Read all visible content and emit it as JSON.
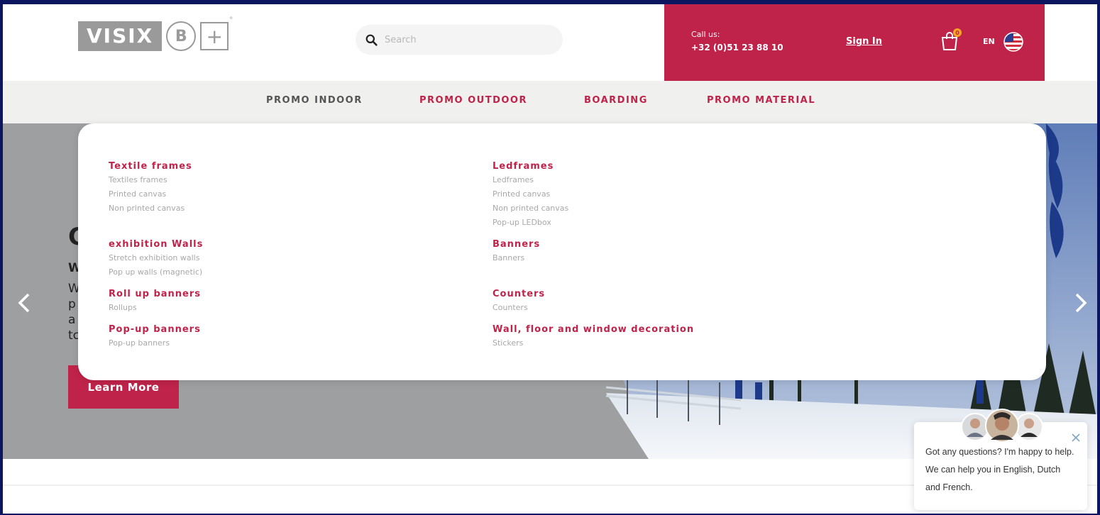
{
  "colors": {
    "brand_red": "#c0234a",
    "header_grey": "#9a9a9a",
    "nav_bg": "#f0f0ee",
    "hero_bg": "#9e9fa1"
  },
  "header": {
    "logo": {
      "word": "VISIX",
      "circle_letter": "B",
      "square_symbol": "+"
    },
    "search": {
      "placeholder": "Search",
      "icon": "search-icon"
    },
    "call": {
      "label": "Call us:",
      "number": "+32 (0)51 23 88 10"
    },
    "sign_in": "Sign In",
    "cart": {
      "icon": "shopping-bag-icon",
      "count": "0"
    },
    "language": {
      "code": "EN",
      "icon": "us-flag-icon"
    }
  },
  "nav": {
    "items": [
      {
        "label": "PROMO INDOOR"
      },
      {
        "label": "PROMO OUTDOOR"
      },
      {
        "label": "BOARDING"
      },
      {
        "label": "PROMO MATERIAL"
      }
    ]
  },
  "mega_menu": {
    "left": [
      {
        "title": "Textile frames",
        "links": [
          "Textiles frames",
          "Printed canvas",
          "Non printed canvas"
        ]
      },
      {
        "title": "exhibition Walls",
        "links": [
          "Stretch exhibition walls",
          "Pop up walls (magnetic)"
        ]
      },
      {
        "title": "Roll up banners",
        "links": [
          "Rollups"
        ]
      },
      {
        "title": "Pop-up banners",
        "links": [
          "Pop-up banners"
        ]
      }
    ],
    "right": [
      {
        "title": "Ledframes",
        "links": [
          "Ledframes",
          "Printed canvas",
          "Non printed canvas",
          "Pop-up LEDbox"
        ]
      },
      {
        "title": "Banners",
        "links": [
          "Banners"
        ]
      },
      {
        "title": "Counters",
        "links": [
          "Counters"
        ]
      },
      {
        "title": "Wall, floor and window decoration",
        "links": [
          "Stickers"
        ]
      }
    ]
  },
  "hero": {
    "heading_fragment": "C",
    "sub_fragment": "W",
    "line_fragments": [
      "W",
      "p",
      "a",
      "tc"
    ],
    "button": "Learn More",
    "prev_icon": "chevron-left-icon",
    "next_icon": "chevron-right-icon"
  },
  "chat": {
    "message": "Got any questions? I'm happy to help. We can help you in English, Dutch and French.",
    "close_icon": "close-icon"
  }
}
